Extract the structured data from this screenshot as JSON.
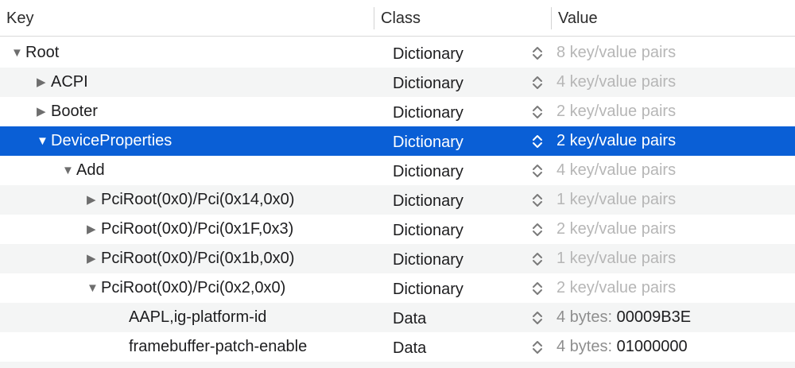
{
  "header": {
    "key_label": "Key",
    "class_label": "Class",
    "value_label": "Value"
  },
  "rows": [
    {
      "disclosure": "▼",
      "key": "Root",
      "class": "Dictionary",
      "value": "8 key/value pairs",
      "stepper_icon": "up-down-chevron-icon"
    },
    {
      "disclosure": "▶",
      "key": "ACPI",
      "class": "Dictionary",
      "value": "4 key/value pairs",
      "stepper_icon": "up-down-chevron-icon"
    },
    {
      "disclosure": "▶",
      "key": "Booter",
      "class": "Dictionary",
      "value": "2 key/value pairs",
      "stepper_icon": "up-down-chevron-icon"
    },
    {
      "disclosure": "▼",
      "key": "DeviceProperties",
      "class": "Dictionary",
      "value": "2 key/value pairs",
      "stepper_icon": "up-down-chevron-icon",
      "selected": true
    },
    {
      "disclosure": "▼",
      "key": "Add",
      "class": "Dictionary",
      "value": "4 key/value pairs",
      "stepper_icon": "up-down-chevron-icon"
    },
    {
      "disclosure": "▶",
      "key": "PciRoot(0x0)/Pci(0x14,0x0)",
      "class": "Dictionary",
      "value": "1 key/value pairs",
      "stepper_icon": "up-down-chevron-icon"
    },
    {
      "disclosure": "▶",
      "key": "PciRoot(0x0)/Pci(0x1F,0x3)",
      "class": "Dictionary",
      "value": "2 key/value pairs",
      "stepper_icon": "up-down-chevron-icon"
    },
    {
      "disclosure": "▶",
      "key": "PciRoot(0x0)/Pci(0x1b,0x0)",
      "class": "Dictionary",
      "value": "1 key/value pairs",
      "stepper_icon": "up-down-chevron-icon"
    },
    {
      "disclosure": "▼",
      "key": "PciRoot(0x0)/Pci(0x2,0x0)",
      "class": "Dictionary",
      "value": "2 key/value pairs",
      "stepper_icon": "up-down-chevron-icon"
    },
    {
      "disclosure": "",
      "key": "AAPL,ig-platform-id",
      "class": "Data",
      "value_prefix": "4 bytes:",
      "value_data": "00009B3E",
      "stepper_icon": "up-down-chevron-icon"
    },
    {
      "disclosure": "",
      "key": "framebuffer-patch-enable",
      "class": "Data",
      "value_prefix": "4 bytes:",
      "value_data": "01000000",
      "stepper_icon": "up-down-chevron-icon"
    }
  ],
  "colors": {
    "selection": "#0a5fd6",
    "alt_row": "#f4f5f5",
    "muted_value": "#b6b6b6"
  }
}
